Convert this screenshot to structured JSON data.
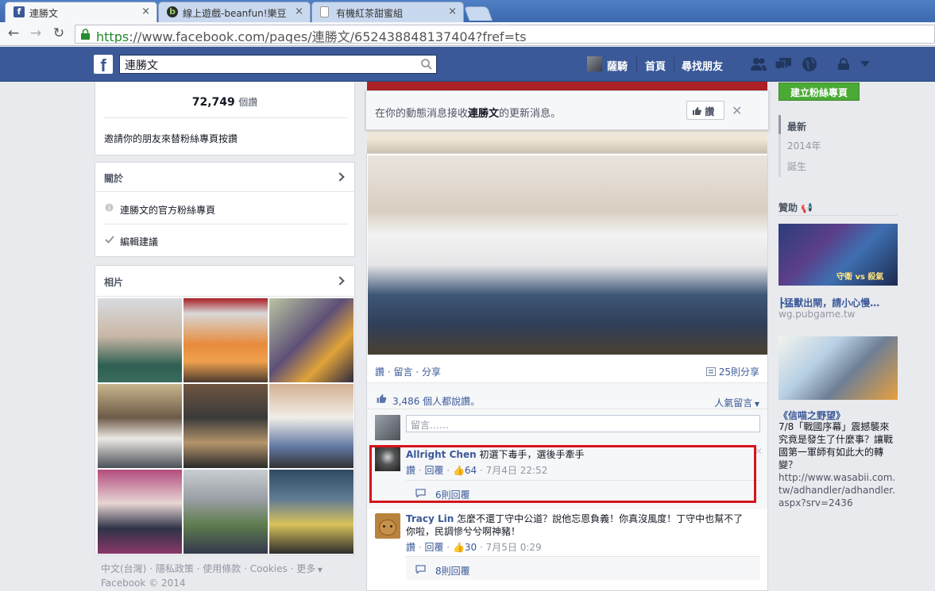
{
  "browser": {
    "tabs": [
      {
        "title": "連勝文",
        "favicon": "facebook-icon"
      },
      {
        "title": "線上遊戲-beanfun!樂豆",
        "favicon": "beanfun-icon"
      },
      {
        "title": "有機紅茶甜蜜組",
        "favicon": "page-icon"
      }
    ],
    "url_scheme": "https",
    "url_rest": "://www.facebook.com/pages/連勝文/652438848137404?fref=ts"
  },
  "header": {
    "search_value": "連勝文",
    "user": "薩騎",
    "home": "首頁",
    "find_friends": "尋找朋友"
  },
  "left": {
    "likes_count": "72,749",
    "likes_unit": "個讚",
    "invite_text": "邀請你的朋友來替粉絲專頁按讚",
    "about_title": "關於",
    "about_item": "連勝文的官方粉絲專頁",
    "edit_suggest": "編輯建議",
    "photos_title": "相片",
    "footer_links": [
      "中文(台灣)",
      "隱私政策",
      "使用條款",
      "Cookies",
      "更多"
    ],
    "copyright": "Facebook © 2014"
  },
  "notify": {
    "text_pre": "在你的動態消息接收",
    "name": "連勝文",
    "text_post": "的更新消息。",
    "like_btn": "讚"
  },
  "post": {
    "like": "讚",
    "comment": "留言",
    "share": "分享",
    "shares_count": "25則分享",
    "likes_summary": "3,486 個人都說讚。",
    "sort": "人氣留言",
    "comment_placeholder": "留言……",
    "comments": [
      {
        "name": "Allright Chen",
        "text": "初選下毒手，選後手牽手",
        "like": "讚",
        "reply": "回覆",
        "likes": "64",
        "time": "7月4日 22:52",
        "replies": "6則回覆"
      },
      {
        "name": "Tracy Lin",
        "text": "怎麼不還丁守中公道？說他忘恩負義！你真沒風度！丁守中也幫不了你啦，民調慘兮兮啊神豬！",
        "like": "讚",
        "reply": "回覆",
        "likes": "30",
        "time": "7月5日 0:29",
        "replies": "8則回覆"
      }
    ]
  },
  "right": {
    "create_btn": "建立粉絲專頁",
    "timeline": [
      "最新",
      "2014年",
      "誕生"
    ],
    "sponsored": "贊助",
    "ads": [
      {
        "title": "┣猛獸出閘，請小心慢…",
        "domain": "wg.pubgame.tw",
        "img_caption": "守衛 vs 殺氣"
      },
      {
        "title": "《信喵之野望》",
        "body": "7/8「戰國序幕」震撼襲來 究竟是發生了什麼事？讓戰國第一軍師有如此大的轉變？",
        "url": "http://www.wasabii.com.tw/adhandler/adhandler.aspx?srv=2436"
      }
    ]
  },
  "colors": {
    "fb_blue": "#3b5998",
    "highlight": "#d4141b",
    "green_btn": "#4ba936"
  }
}
